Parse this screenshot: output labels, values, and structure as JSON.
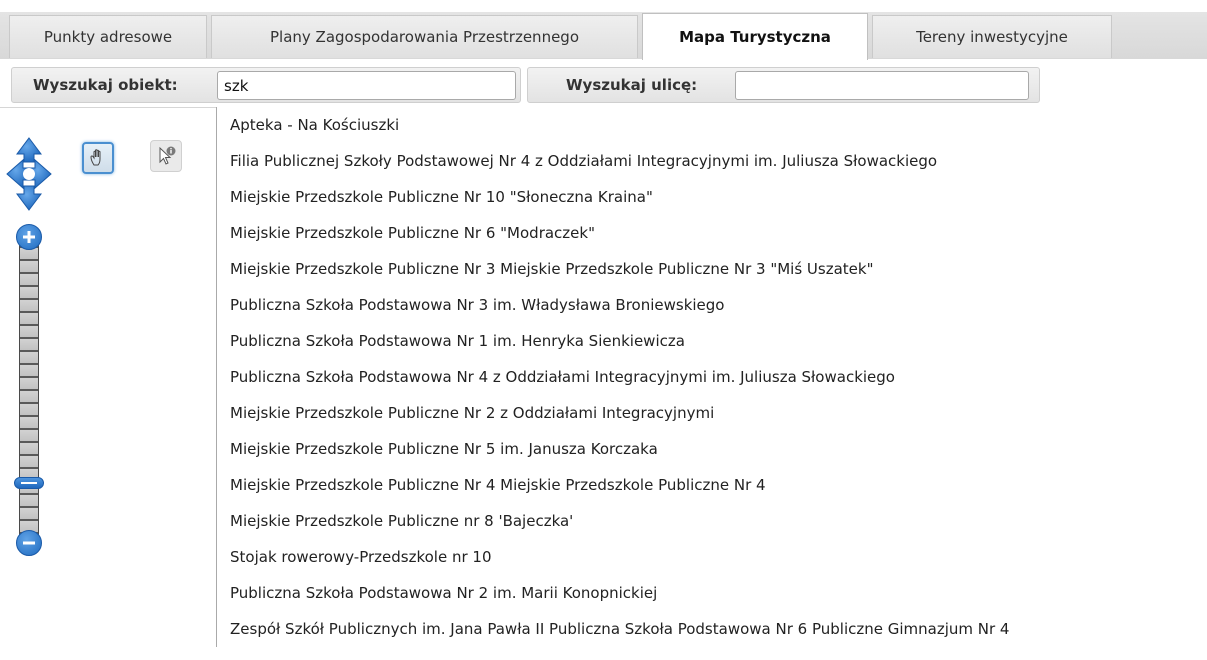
{
  "tabs": [
    {
      "label": "Punkty adresowe",
      "active": false
    },
    {
      "label": "Plany Zagospodarowania Przestrzennego",
      "active": false
    },
    {
      "label": "Mapa Turystyczna",
      "active": true
    },
    {
      "label": "Tereny inwestycyjne",
      "active": false
    }
  ],
  "search": {
    "object_label": "Wyszukaj obiekt:",
    "object_value": "szk",
    "street_label": "Wyszukaj ulicę:",
    "street_value": ""
  },
  "tools": {
    "pan_icon": "hand-icon",
    "info_icon": "info-pointer-icon"
  },
  "zoom": {
    "level_fraction": 0.2
  },
  "colors": {
    "accent": "#1f6bc0",
    "active_tab": "#ffffff",
    "tab_strip": "#dcdcdc"
  },
  "suggestions": [
    "Apteka - Na Kościuszki",
    "Filia Publicznej Szkoły Podstawowej Nr 4 z Oddziałami Integracyjnymi im. Juliusza Słowackiego",
    "Miejskie Przedszkole Publiczne Nr 10 \"Słoneczna Kraina\"",
    "Miejskie Przedszkole Publiczne Nr 6 \"Modraczek\"",
    "Miejskie Przedszkole Publiczne Nr 3 Miejskie Przedszkole Publiczne Nr 3 \"Miś Uszatek\"",
    "Publiczna Szkoła Podstawowa Nr 3 im. Władysława Broniewskiego",
    "Publiczna Szkoła Podstawowa Nr 1 im. Henryka Sienkiewicza",
    "Publiczna Szkoła Podstawowa Nr 4 z Oddziałami Integracyjnymi im. Juliusza Słowackiego",
    "Miejskie Przedszkole Publiczne Nr 2 z Oddziałami Integracyjnymi",
    "Miejskie Przedszkole Publiczne Nr 5 im. Janusza Korczaka",
    "Miejskie Przedszkole Publiczne Nr 4 Miejskie Przedszkole Publiczne Nr 4",
    "Miejskie Przedszkole Publiczne nr 8 'Bajeczka'",
    "Stojak rowerowy-Przedszkole nr 10",
    "Publiczna Szkoła Podstawowa Nr 2 im. Marii Konopnickiej",
    "Zespół Szkół Publicznych im. Jana Pawła II Publiczna Szkoła Podstawowa Nr 6 Publiczne Gimnazjum Nr 4"
  ]
}
